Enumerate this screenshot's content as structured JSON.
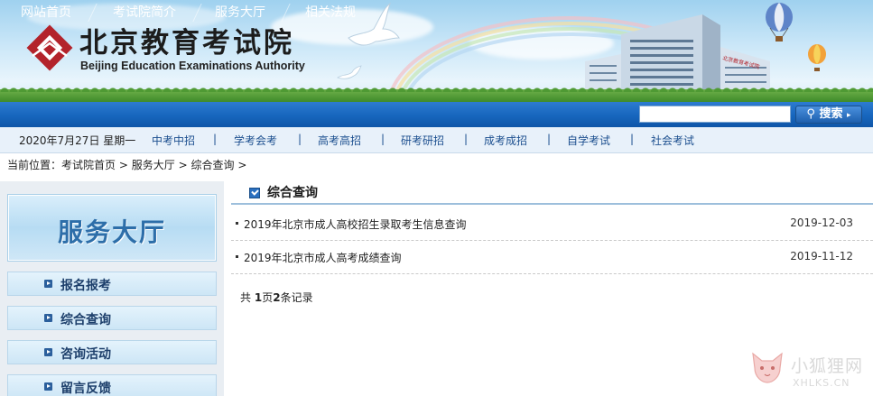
{
  "header": {
    "logo_cn": "北京教育考试院",
    "logo_en": "Beijing Education Examinations Authority"
  },
  "nav": {
    "items": [
      "网站首页",
      "考试院简介",
      "服务大厅",
      "相关法规"
    ],
    "search_placeholder": "",
    "search_label": "搜索"
  },
  "subnav": {
    "date": "2020年7月27日 星期一",
    "items": [
      "中考中招",
      "学考会考",
      "高考高招",
      "研考研招",
      "成考成招",
      "自学考试",
      "社会考试"
    ],
    "separator": "|"
  },
  "breadcrumb": {
    "prefix": "当前位置：",
    "items": [
      "考试院首页",
      "服务大厅",
      "综合查询"
    ],
    "separator": ">"
  },
  "sidebar": {
    "title": "服务大厅",
    "items": [
      "报名报考",
      "综合查询",
      "咨询活动",
      "留言反馈"
    ]
  },
  "main": {
    "section_title": "综合查询",
    "rows": [
      {
        "title": "2019年北京市成人高校招生录取考生信息查询",
        "date": "2019-12-03"
      },
      {
        "title": "2019年北京市成人高考成绩查询",
        "date": "2019-11-12"
      }
    ],
    "pager": {
      "gong": "共",
      "pages": "1",
      "ye": "页",
      "count": "2",
      "tiao": "条记录"
    }
  },
  "watermark": {
    "cn": "小狐狸网",
    "en": "XHLKS.CN"
  },
  "colors": {
    "nav_blue": "#1766bd",
    "link_blue": "#1c4f8f",
    "sidebar_title": "#2d6ea9"
  }
}
